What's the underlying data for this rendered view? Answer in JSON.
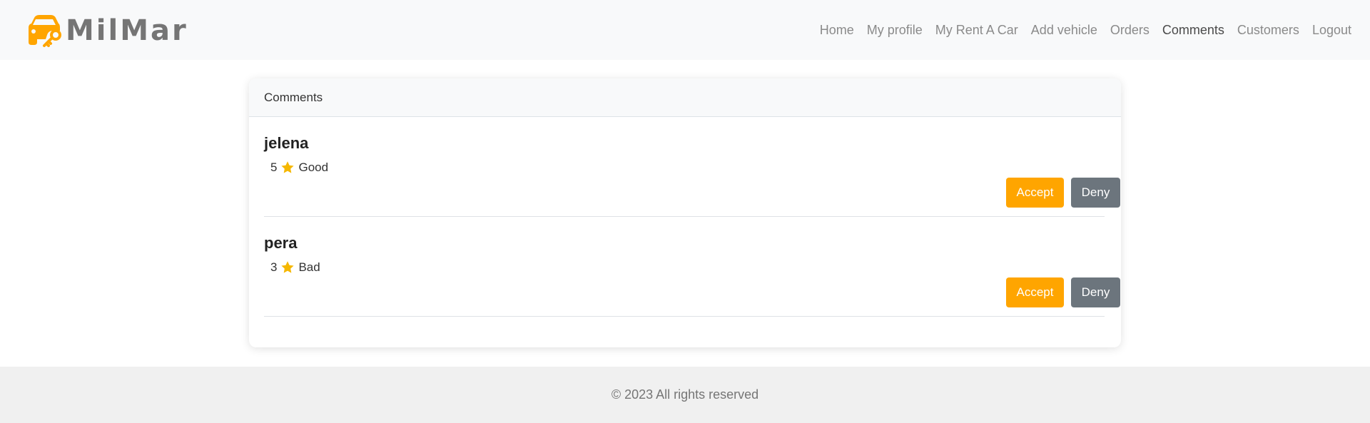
{
  "brand": {
    "name": "MilMar",
    "accent": "#ffa500",
    "logo_icon": "car-key-icon"
  },
  "nav": {
    "items": [
      {
        "label": "Home",
        "active": false
      },
      {
        "label": "My profile",
        "active": false
      },
      {
        "label": "My Rent A Car",
        "active": false
      },
      {
        "label": "Add vehicle",
        "active": false
      },
      {
        "label": "Orders",
        "active": false
      },
      {
        "label": "Comments",
        "active": true
      },
      {
        "label": "Customers",
        "active": false
      },
      {
        "label": "Logout",
        "active": false
      }
    ]
  },
  "card": {
    "title": "Comments",
    "comments": [
      {
        "user": "jelena",
        "rating": "5",
        "text": "Good",
        "accept_label": "Accept",
        "deny_label": "Deny"
      },
      {
        "user": "pera",
        "rating": "3",
        "text": "Bad",
        "accept_label": "Accept",
        "deny_label": "Deny"
      }
    ]
  },
  "colors": {
    "accept": "#ffa500",
    "deny": "#6c757d",
    "star": "#f5b700"
  },
  "footer": {
    "text": "© 2023 All rights reserved"
  }
}
